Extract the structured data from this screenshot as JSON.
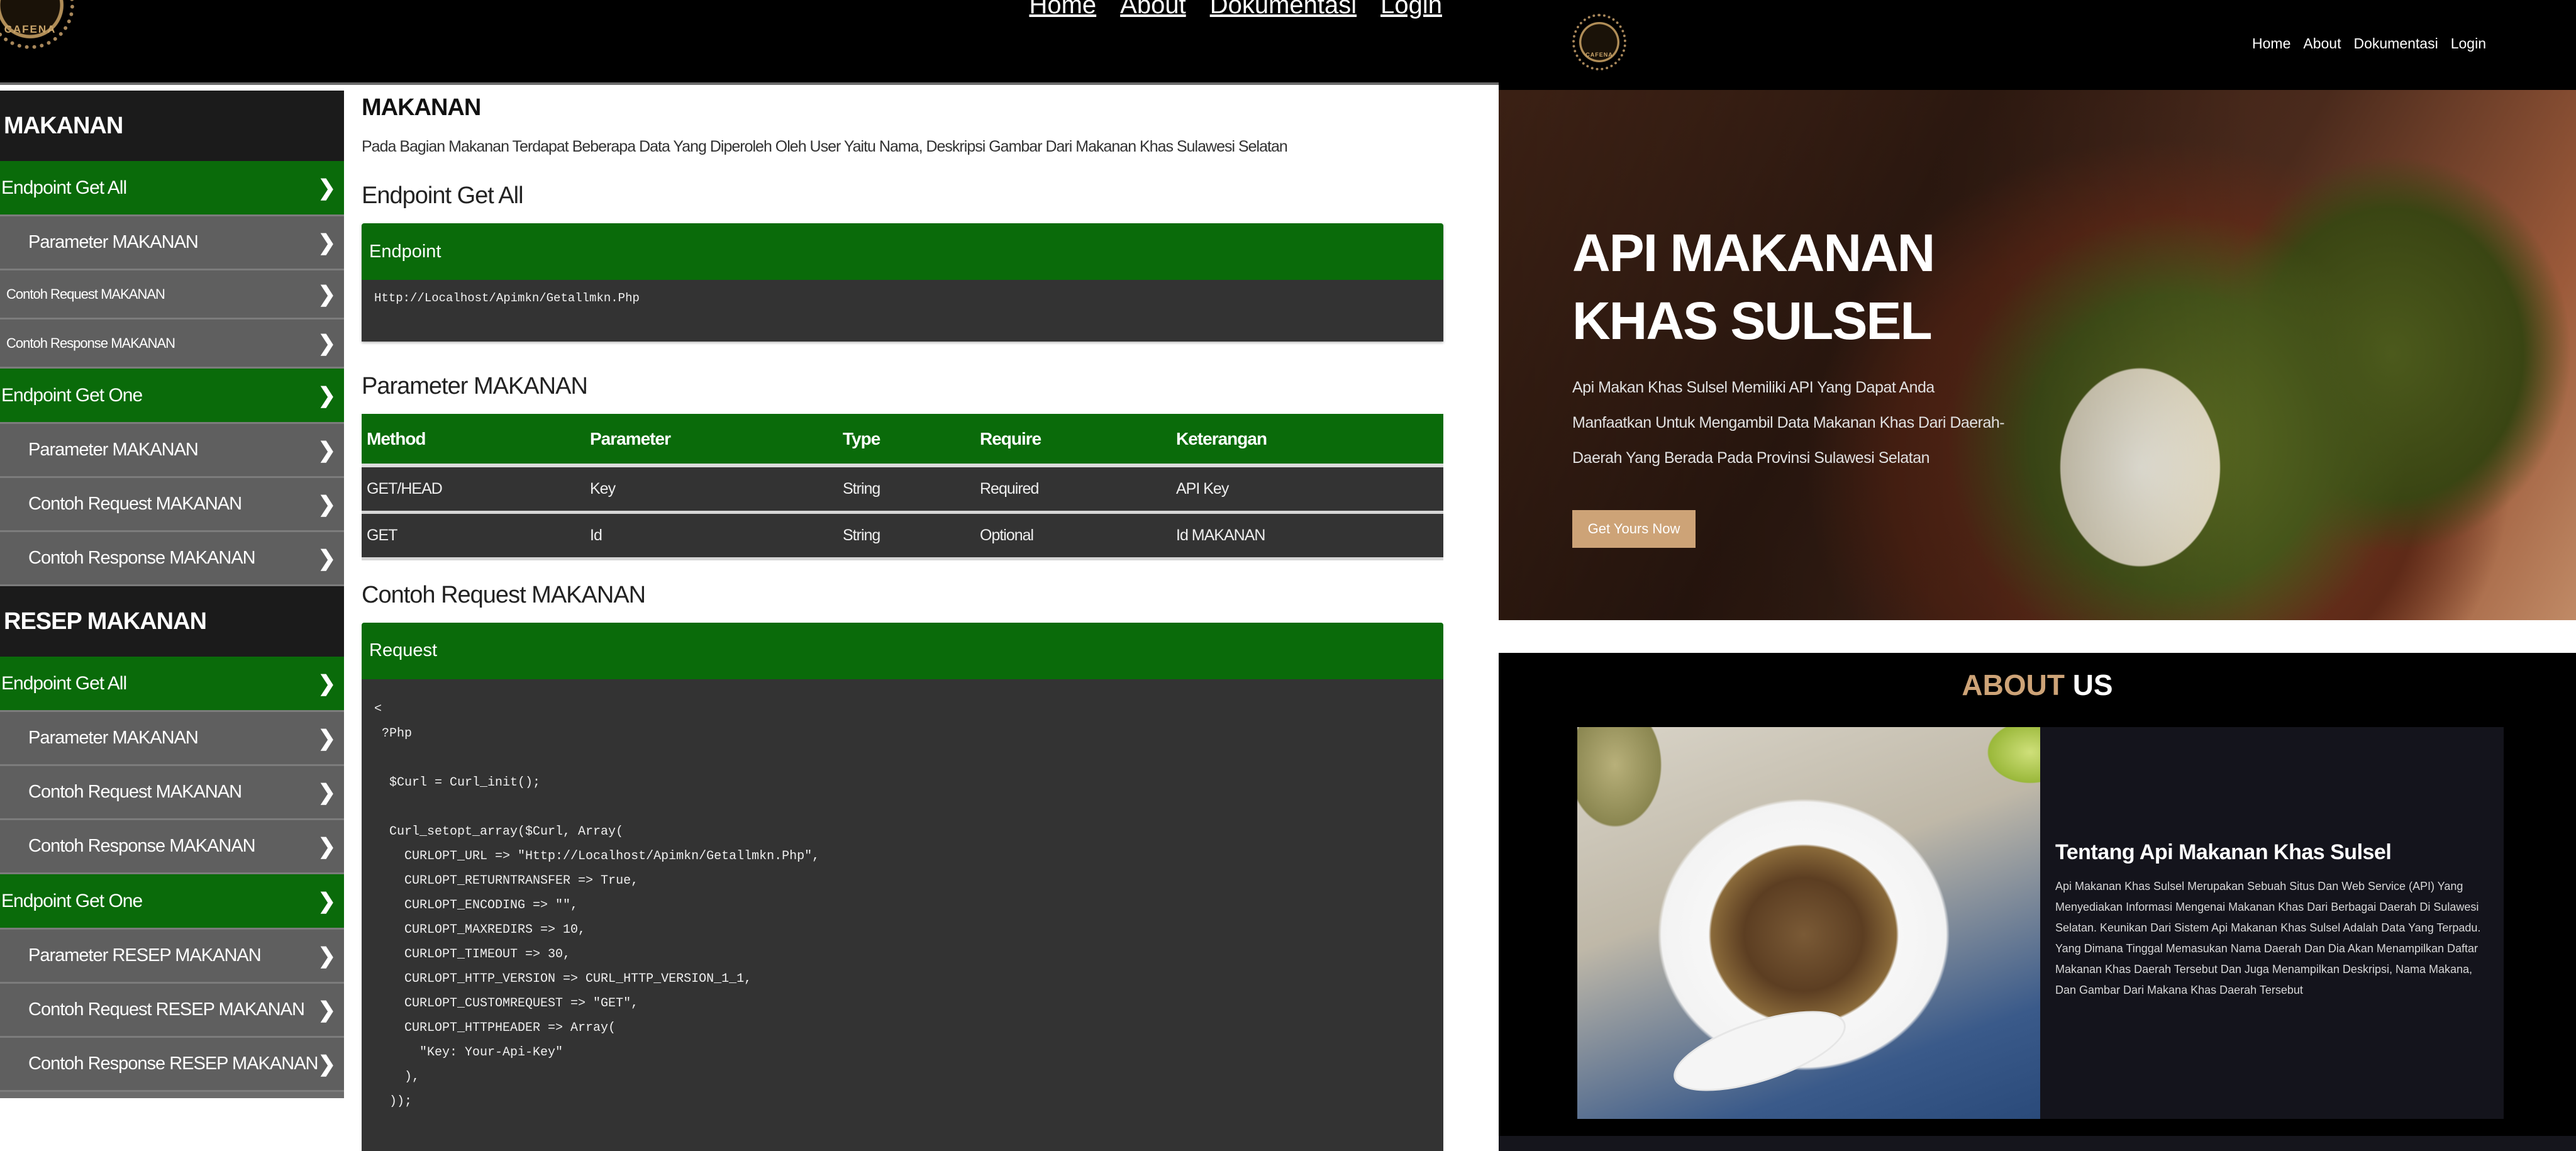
{
  "left": {
    "logo_text": "CAFENA",
    "nav": [
      "Home",
      "About",
      "Dokumentasi",
      "Login"
    ],
    "sidebar": [
      {
        "type": "head",
        "label": "MAKANAN"
      },
      {
        "type": "green",
        "label": "Endpoint Get All"
      },
      {
        "type": "sub",
        "label": "Parameter MAKANAN"
      },
      {
        "type": "small",
        "label": "Contoh Request MAKANAN"
      },
      {
        "type": "small",
        "label": "Contoh Response MAKANAN"
      },
      {
        "type": "green",
        "label": "Endpoint Get One"
      },
      {
        "type": "sub",
        "label": "Parameter MAKANAN"
      },
      {
        "type": "sub",
        "label": "Contoh Request MAKANAN"
      },
      {
        "type": "sub",
        "label": "Contoh Response MAKANAN"
      },
      {
        "type": "head",
        "label": "RESEP MAKANAN"
      },
      {
        "type": "green",
        "label": "Endpoint Get All"
      },
      {
        "type": "sub",
        "label": "Parameter MAKANAN"
      },
      {
        "type": "sub",
        "label": "Contoh Request MAKANAN"
      },
      {
        "type": "sub",
        "label": "Contoh Response MAKANAN"
      },
      {
        "type": "green",
        "label": "Endpoint Get One"
      },
      {
        "type": "sub",
        "label": "Parameter RESEP MAKANAN"
      },
      {
        "type": "sub",
        "label": "Contoh Request RESEP MAKANAN"
      },
      {
        "type": "sub",
        "label": "Contoh Response RESEP MAKANAN"
      }
    ],
    "content": {
      "title": "MAKANAN",
      "description": "Pada Bagian Makanan Terdapat Beberapa Data Yang Diperoleh Oleh User Yaitu Nama, Deskripsi Gambar Dari Makanan Khas Sulawesi Selatan",
      "endpoint_section": "Endpoint Get All",
      "endpoint_label": "Endpoint",
      "endpoint_url": "Http://Localhost/Apimkn/Getallmkn.Php",
      "param_section": "Parameter MAKANAN",
      "param_headers": [
        "Method",
        "Parameter",
        "Type",
        "Require",
        "Keterangan"
      ],
      "param_rows": [
        [
          "GET/HEAD",
          "Key",
          "String",
          "Required",
          "API Key"
        ],
        [
          "GET",
          "Id",
          "String",
          "Optional",
          "Id MAKANAN"
        ]
      ],
      "request_section": "Contoh Request MAKANAN",
      "request_label": "Request",
      "code_lines": [
        "<",
        " ?Php",
        "",
        "  $Curl = Curl_init();",
        "",
        "  Curl_setopt_array($Curl, Array(",
        "    CURLOPT_URL => \"Http://Localhost/Apimkn/Getallmkn.Php\",",
        "    CURLOPT_RETURNTRANSFER => True,",
        "    CURLOPT_ENCODING => \"\",",
        "    CURLOPT_MAXREDIRS => 10,",
        "    CURLOPT_TIMEOUT => 30,",
        "    CURLOPT_HTTP_VERSION => CURL_HTTP_VERSION_1_1,",
        "    CURLOPT_CUSTOMREQUEST => \"GET\",",
        "    CURLOPT_HTTPHEADER => Array(",
        "      \"Key: Your-Api-Key\"",
        "    ),",
        "  ));"
      ]
    }
  },
  "right": {
    "logo_text": "CAFENA",
    "nav": [
      "Home",
      "About",
      "Dokumentasi",
      "Login"
    ],
    "hero": {
      "title": "API MAKANAN KHAS SULSEL",
      "description": "Api Makan Khas Sulsel Memiliki API Yang Dapat Anda Manfaatkan Untuk Mengambil Data Makanan Khas Dari Daerah-Daerah Yang Berada Pada Provinsi Sulawesi Selatan",
      "button": "Get Yours Now"
    },
    "about": {
      "title_accent": "ABOUT",
      "title_rest": "US",
      "heading": "Tentang Api Makanan Khas Sulsel",
      "body": "Api Makanan Khas Sulsel Merupakan Sebuah Situs Dan Web Service (API) Yang Menyediakan Informasi Mengenai Makanan Khas Dari Berbagai Daerah Di Sulawesi Selatan. Keunikan Dari Sistem Api Makanan Khas Sulsel Adalah Data Yang Terpadu. Yang Dimana Tinggal Memasukan Nama Daerah Dan Dia Akan Menampilkan Daftar Makanan Khas Daerah Tersebut Dan Juga Menampilkan Deskripsi, Nama Makana, Dan Gambar Dari Makana Khas Daerah Tersebut"
    },
    "colors": {
      "green": "#0a6b0a",
      "gold": "#cda377",
      "dark_panel": "#333333"
    }
  }
}
